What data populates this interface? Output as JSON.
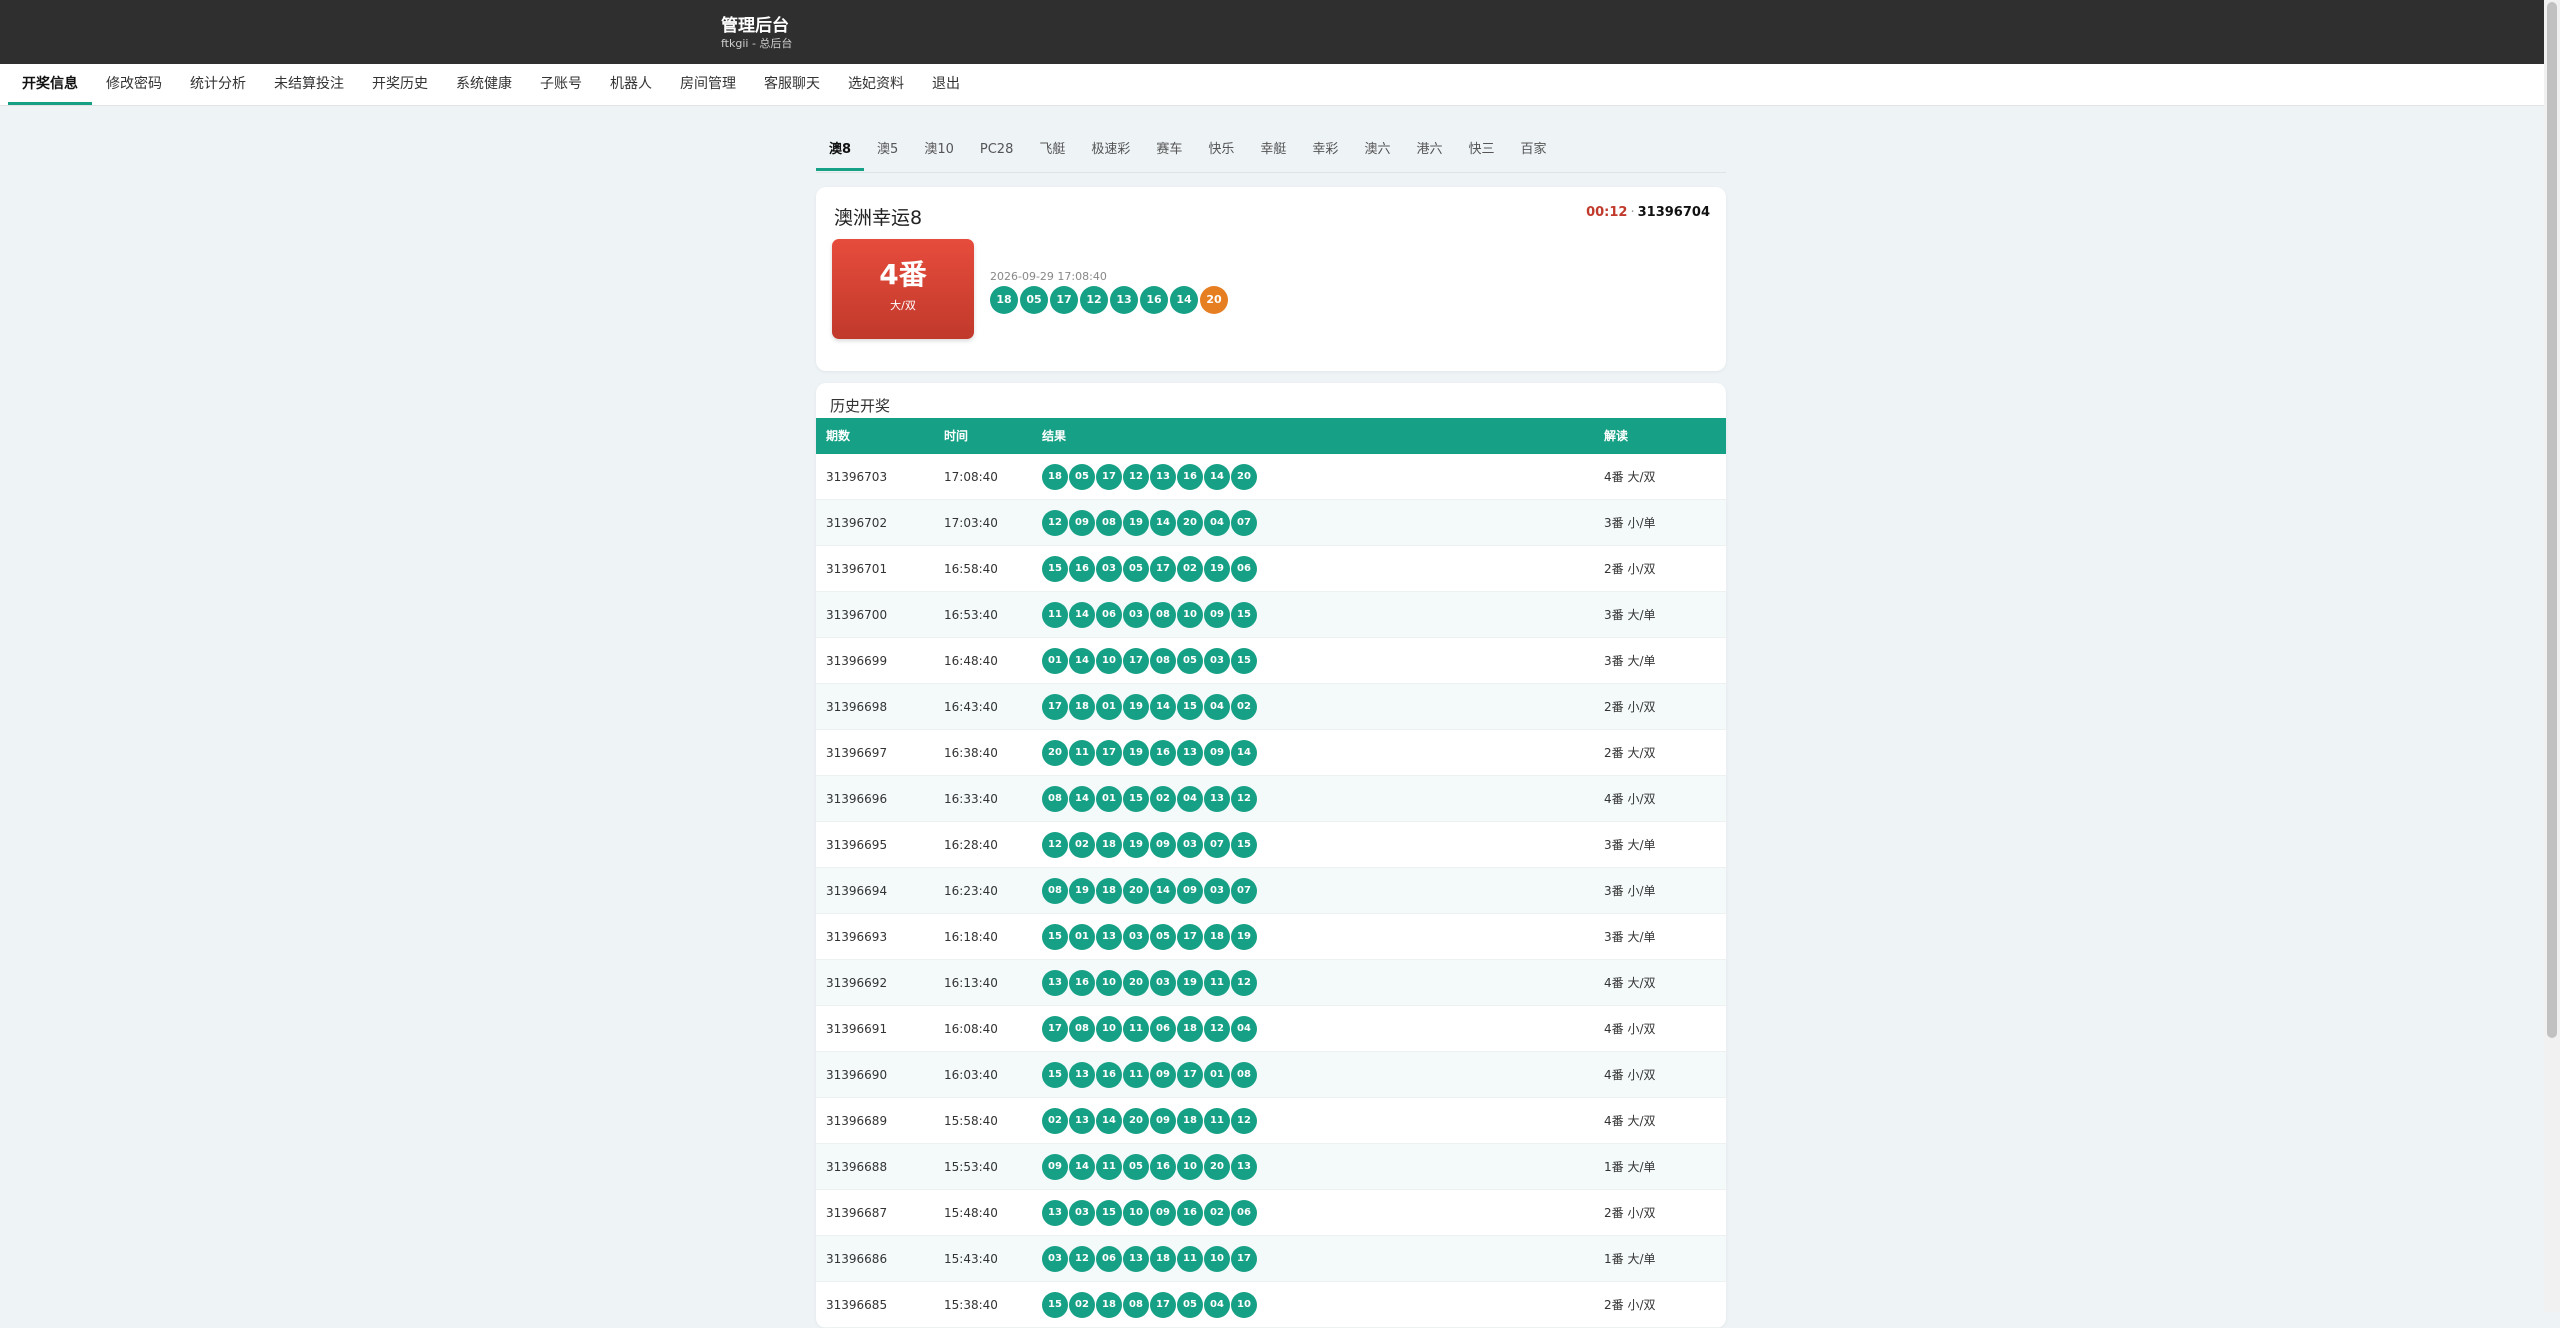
{
  "header": {
    "title": "管理后台",
    "subtitle": "ftkgii - 总后台"
  },
  "nav": [
    "开奖信息",
    "修改密码",
    "统计分析",
    "未结算投注",
    "开奖历史",
    "系统健康",
    "子账号",
    "机器人",
    "房间管理",
    "客服聊天",
    "选妃资料",
    "退出"
  ],
  "lottery_tabs": [
    "澳8",
    "澳5",
    "澳10",
    "PC28",
    "飞艇",
    "极速彩",
    "赛车",
    "快乐",
    "幸艇",
    "幸彩",
    "澳六",
    "港六",
    "快三",
    "百家"
  ],
  "current": {
    "game_name": "澳洲幸运8",
    "countdown": "00:12",
    "separator": "·",
    "issue": "31396704",
    "result_num": "4番",
    "result_desc": "大/双",
    "draw_time": "2026-09-29 17:08:40",
    "balls": [
      "18",
      "05",
      "17",
      "12",
      "13",
      "16",
      "14",
      "20"
    ]
  },
  "history": {
    "title": "历史开奖",
    "columns": {
      "issue": "期数",
      "time": "时间",
      "result": "结果",
      "interp": "解读"
    },
    "rows": [
      {
        "issue": "31396703",
        "time": "17:08:40",
        "balls": [
          "18",
          "05",
          "17",
          "12",
          "13",
          "16",
          "14",
          "20"
        ],
        "interp": "4番 大/双"
      },
      {
        "issue": "31396702",
        "time": "17:03:40",
        "balls": [
          "12",
          "09",
          "08",
          "19",
          "14",
          "20",
          "04",
          "07"
        ],
        "interp": "3番 小/单"
      },
      {
        "issue": "31396701",
        "time": "16:58:40",
        "balls": [
          "15",
          "16",
          "03",
          "05",
          "17",
          "02",
          "19",
          "06"
        ],
        "interp": "2番 小/双"
      },
      {
        "issue": "31396700",
        "time": "16:53:40",
        "balls": [
          "11",
          "14",
          "06",
          "03",
          "08",
          "10",
          "09",
          "15"
        ],
        "interp": "3番 大/单"
      },
      {
        "issue": "31396699",
        "time": "16:48:40",
        "balls": [
          "01",
          "14",
          "10",
          "17",
          "08",
          "05",
          "03",
          "15"
        ],
        "interp": "3番 大/单"
      },
      {
        "issue": "31396698",
        "time": "16:43:40",
        "balls": [
          "17",
          "18",
          "01",
          "19",
          "14",
          "15",
          "04",
          "02"
        ],
        "interp": "2番 小/双"
      },
      {
        "issue": "31396697",
        "time": "16:38:40",
        "balls": [
          "20",
          "11",
          "17",
          "19",
          "16",
          "13",
          "09",
          "14"
        ],
        "interp": "2番 大/双"
      },
      {
        "issue": "31396696",
        "time": "16:33:40",
        "balls": [
          "08",
          "14",
          "01",
          "15",
          "02",
          "04",
          "13",
          "12"
        ],
        "interp": "4番 小/双"
      },
      {
        "issue": "31396695",
        "time": "16:28:40",
        "balls": [
          "12",
          "02",
          "18",
          "19",
          "09",
          "03",
          "07",
          "15"
        ],
        "interp": "3番 大/单"
      },
      {
        "issue": "31396694",
        "time": "16:23:40",
        "balls": [
          "08",
          "19",
          "18",
          "20",
          "14",
          "09",
          "03",
          "07"
        ],
        "interp": "3番 小/单"
      },
      {
        "issue": "31396693",
        "time": "16:18:40",
        "balls": [
          "15",
          "01",
          "13",
          "03",
          "05",
          "17",
          "18",
          "19"
        ],
        "interp": "3番 大/单"
      },
      {
        "issue": "31396692",
        "time": "16:13:40",
        "balls": [
          "13",
          "16",
          "10",
          "20",
          "03",
          "19",
          "11",
          "12"
        ],
        "interp": "4番 大/双"
      },
      {
        "issue": "31396691",
        "time": "16:08:40",
        "balls": [
          "17",
          "08",
          "10",
          "11",
          "06",
          "18",
          "12",
          "04"
        ],
        "interp": "4番 小/双"
      },
      {
        "issue": "31396690",
        "time": "16:03:40",
        "balls": [
          "15",
          "13",
          "16",
          "11",
          "09",
          "17",
          "01",
          "08"
        ],
        "interp": "4番 小/双"
      },
      {
        "issue": "31396689",
        "time": "15:58:40",
        "balls": [
          "02",
          "13",
          "14",
          "20",
          "09",
          "18",
          "11",
          "12"
        ],
        "interp": "4番 大/双"
      },
      {
        "issue": "31396688",
        "time": "15:53:40",
        "balls": [
          "09",
          "14",
          "11",
          "05",
          "16",
          "10",
          "20",
          "13"
        ],
        "interp": "1番 大/单"
      },
      {
        "issue": "31396687",
        "time": "15:48:40",
        "balls": [
          "13",
          "03",
          "15",
          "10",
          "09",
          "16",
          "02",
          "06"
        ],
        "interp": "2番 小/双"
      },
      {
        "issue": "31396686",
        "time": "15:43:40",
        "balls": [
          "03",
          "12",
          "06",
          "13",
          "18",
          "11",
          "10",
          "17"
        ],
        "interp": "1番 大/单"
      },
      {
        "issue": "31396685",
        "time": "15:38:40",
        "balls": [
          "15",
          "02",
          "18",
          "08",
          "17",
          "05",
          "04",
          "10"
        ],
        "interp": "2番 小/双"
      }
    ]
  },
  "colors": {
    "accent": "#16a085",
    "result_red": "#c0392b",
    "special_ball": "#e67e22",
    "topbar": "#2f2f2f"
  }
}
